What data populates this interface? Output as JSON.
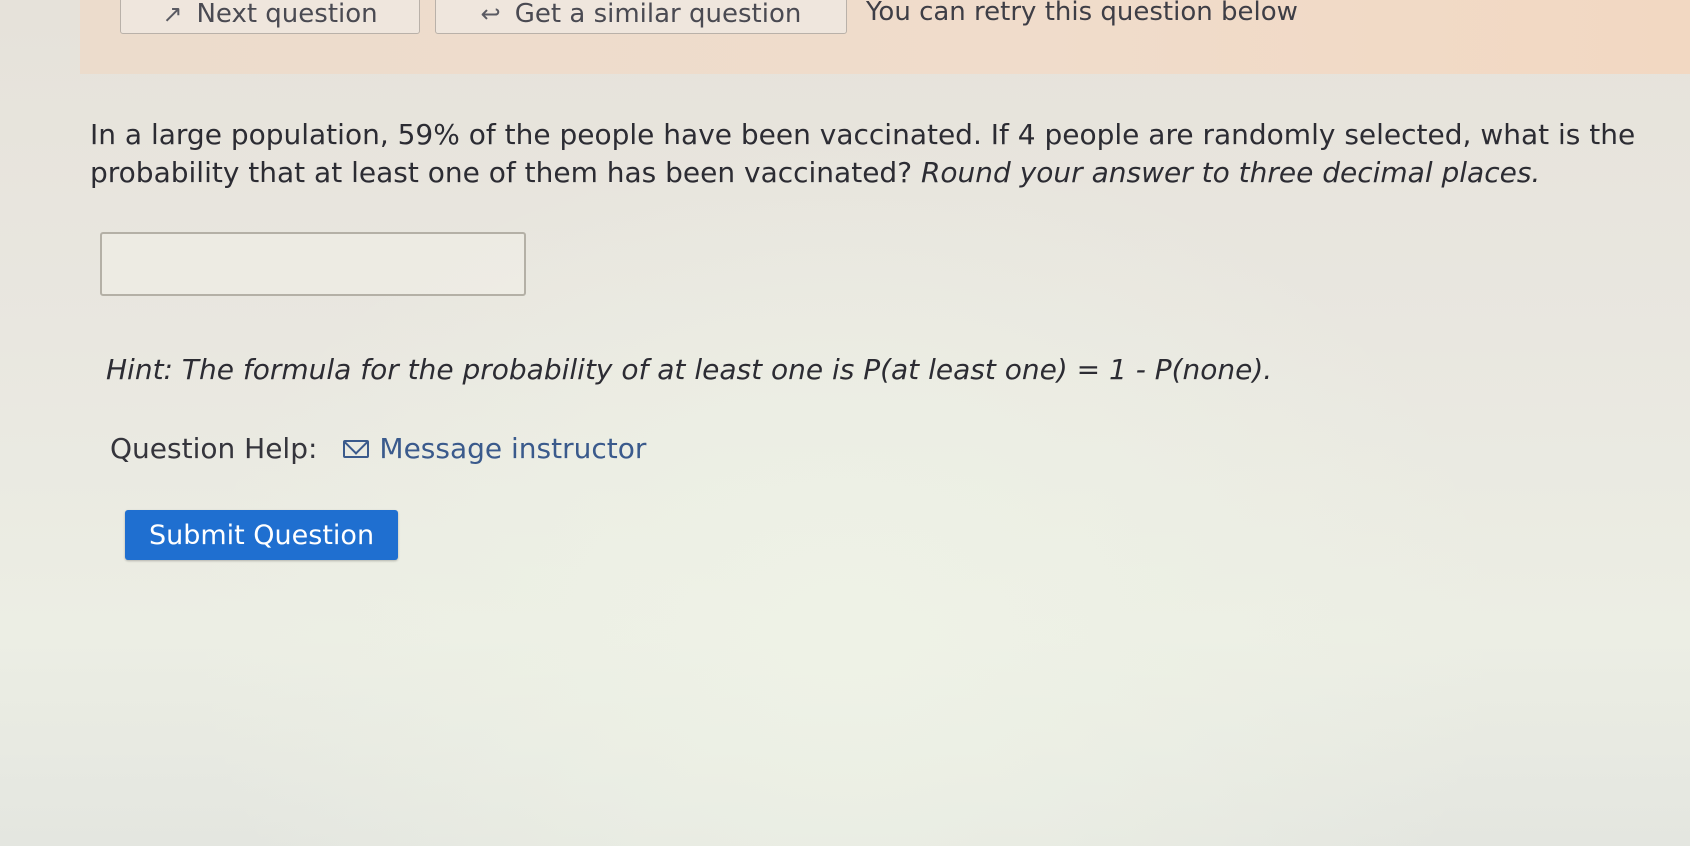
{
  "top_bar": {
    "next_question_label": "Next question",
    "next_icon": "arrow-right-icon",
    "similar_question_label": "Get a similar question",
    "similar_icon": "return-arrow-icon",
    "retry_text": "You can retry this question below"
  },
  "question": {
    "text": "In a large population, 59% of the people have been vaccinated. If 4 people are randomly selected, what is the probability that at least one of them has been vaccinated?",
    "instruction": "Round your answer to three decimal places."
  },
  "answer": {
    "value": "",
    "placeholder": ""
  },
  "hint": {
    "text": "Hint: The formula for the probability of at least one is P(at least one) = 1 - P(none)."
  },
  "help": {
    "label": "Question Help:",
    "message_link": "Message instructor",
    "message_icon": "envelope-icon"
  },
  "submit": {
    "label": "Submit Question",
    "color": "#1f6fd0"
  }
}
